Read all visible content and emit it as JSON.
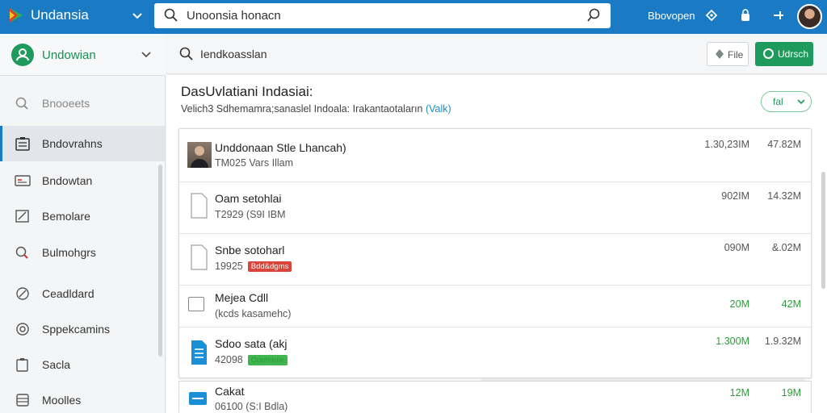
{
  "app": {
    "name": "Undansia",
    "search_text": "Unoonsia honacn",
    "user_name": "Bbovopen"
  },
  "colors": {
    "topbar": "#1a7bc4",
    "accent_green": "#1d9a5c",
    "link": "#1a8fc4"
  },
  "org": {
    "name": "Undowian"
  },
  "sidebar": {
    "items": [
      {
        "label": "Bnooeets",
        "icon": "search-icon"
      },
      {
        "label": "Bndovrahns",
        "icon": "clipboard-icon"
      },
      {
        "label": "Bndowtan",
        "icon": "card-icon"
      },
      {
        "label": "Bemolare",
        "icon": "edit-icon"
      },
      {
        "label": "Bulmohgrs",
        "icon": "magnify-icon"
      },
      {
        "label": "Ceadldard",
        "icon": "pen-icon"
      },
      {
        "label": "Sppekcamins",
        "icon": "gear-icon"
      },
      {
        "label": "Sacla",
        "icon": "copy-icon"
      },
      {
        "label": "Moolles",
        "icon": "grid-icon"
      }
    ]
  },
  "toolbar": {
    "search_text": "Iendkoasslan",
    "file_label": "File",
    "primary_label": "Udrsch"
  },
  "page": {
    "title": "DasUvlatiani Indasiai:",
    "subtitle": "Velich3 Sdhemamra;sanaslel Indoala: Irakantaotaların",
    "subtitle_link": "(Valk)",
    "filter_label": "fal"
  },
  "rows": [
    {
      "title": "Unddonaan Stle Lhancah)",
      "subtitle": "TM025 Vars Illam",
      "badge": "",
      "v1": "1.30,23IM",
      "v2": "47.82M",
      "green": false,
      "thumb": "photo-thumbnail"
    },
    {
      "title": "Oam setohlai",
      "subtitle": "T2929 (S9I IBM",
      "badge": "",
      "v1": "902IM",
      "v2": "14.32M",
      "green": false,
      "thumb": "document-icon"
    },
    {
      "title": "Snbe sotoharl",
      "subtitle": "19925",
      "badge": "Bdd&dgms",
      "badge_color": "red",
      "v1": "090M",
      "v2": "&.02M",
      "green": false,
      "thumb": "document-icon"
    },
    {
      "title": "Mejea Cdll",
      "subtitle": "(kcds kasamehc)",
      "badge": "",
      "v1": "20M",
      "v2": "42M",
      "green": true,
      "thumb": "checkbox"
    },
    {
      "title": "Sdoo sata (akj",
      "subtitle": "42098",
      "badge": "Ounhanie",
      "badge_color": "green",
      "v1": "1.300M",
      "v2": "1.9.32M",
      "green": "v1",
      "thumb": "blue-doc-icon"
    }
  ],
  "last_row": {
    "title": "Cakat",
    "subtitle": "06100 (S:I Bdla)",
    "v1": "12M",
    "v2": "19M"
  }
}
